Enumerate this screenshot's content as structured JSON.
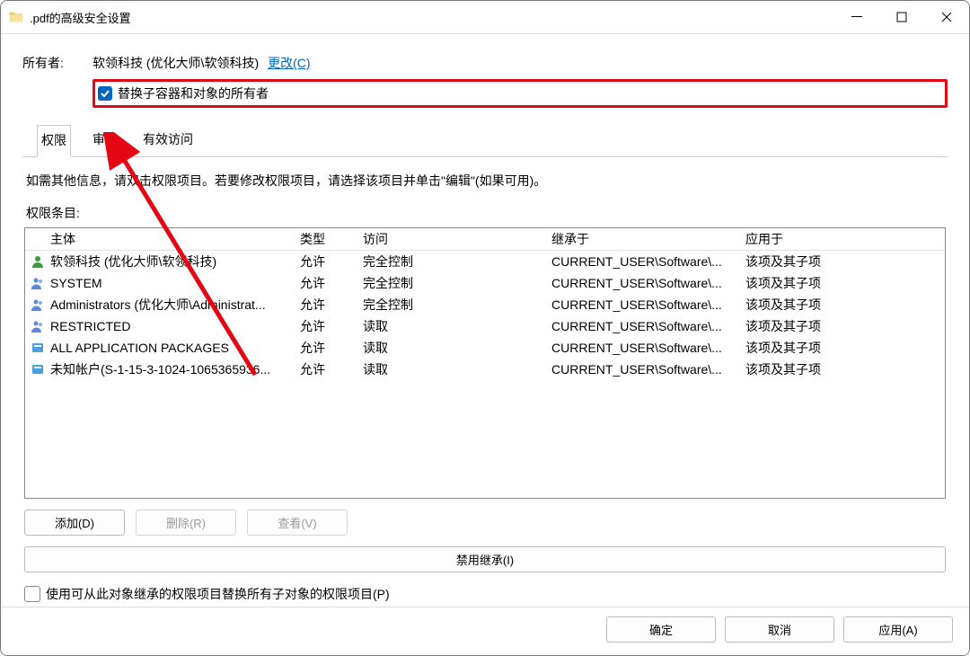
{
  "window": {
    "title": ".pdf的高级安全设置"
  },
  "owner": {
    "label": "所有者:",
    "value": "软领科技 (优化大师\\软领科技)",
    "change_link": "更改(C)",
    "replace_checkbox_label": "替换子容器和对象的所有者",
    "replace_checked": true
  },
  "tabs": {
    "permissions": "权限",
    "audit": "审核",
    "effective": "有效访问",
    "active": "permissions"
  },
  "info": "如需其他信息，请双击权限项目。若要修改权限项目，请选择该项目并单击\"编辑\"(如果可用)。",
  "entries_label": "权限条目:",
  "columns": {
    "subject": "主体",
    "type": "类型",
    "access": "访问",
    "inherit": "继承于",
    "apply": "应用于"
  },
  "rows": [
    {
      "icon": "user",
      "subject": "软领科技 (优化大师\\软领科技)",
      "type": "允许",
      "access": "完全控制",
      "inherit": "CURRENT_USER\\Software\\...",
      "apply": "该项及其子项"
    },
    {
      "icon": "group",
      "subject": "SYSTEM",
      "type": "允许",
      "access": "完全控制",
      "inherit": "CURRENT_USER\\Software\\...",
      "apply": "该项及其子项"
    },
    {
      "icon": "group",
      "subject": "Administrators (优化大师\\Administrat...",
      "type": "允许",
      "access": "完全控制",
      "inherit": "CURRENT_USER\\Software\\...",
      "apply": "该项及其子项"
    },
    {
      "icon": "group",
      "subject": "RESTRICTED",
      "type": "允许",
      "access": "读取",
      "inherit": "CURRENT_USER\\Software\\...",
      "apply": "该项及其子项"
    },
    {
      "icon": "pkg",
      "subject": "ALL APPLICATION PACKAGES",
      "type": "允许",
      "access": "读取",
      "inherit": "CURRENT_USER\\Software\\...",
      "apply": "该项及其子项"
    },
    {
      "icon": "pkg",
      "subject": "未知帐户(S-1-15-3-1024-1065365936...",
      "type": "允许",
      "access": "读取",
      "inherit": "CURRENT_USER\\Software\\...",
      "apply": "该项及其子项"
    }
  ],
  "buttons": {
    "add": "添加(D)",
    "remove": "删除(R)",
    "view": "查看(V)",
    "disable_inherit": "禁用继承(I)"
  },
  "replace_children": {
    "label": "使用可从此对象继承的权限项目替换所有子对象的权限项目(P)",
    "checked": false
  },
  "footer": {
    "ok": "确定",
    "cancel": "取消",
    "apply": "应用(A)"
  }
}
